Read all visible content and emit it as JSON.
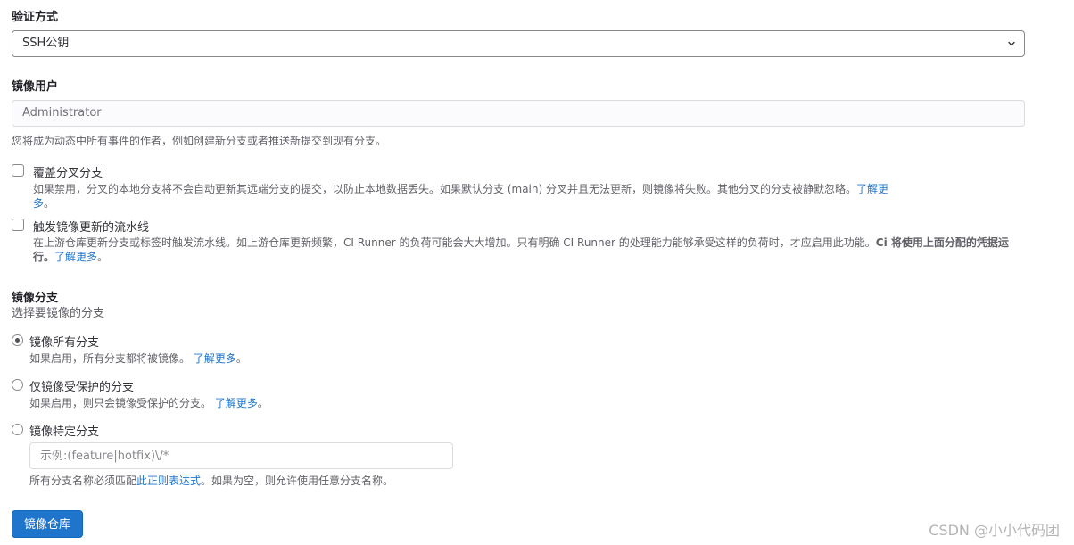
{
  "auth": {
    "label": "验证方式",
    "selected": "SSH公钥"
  },
  "mirror_user": {
    "label": "镜像用户",
    "value": "Administrator",
    "help": "您将成为动态中所有事件的作者，例如创建新分支或者推送新提交到现有分支。"
  },
  "overwrite": {
    "label": "覆盖分叉分支",
    "help_line1": "如果禁用，分叉的本地分支将不会自动更新其远端分支的提交，以防止本地数据丢失。如果默认分支 (main) 分叉并且无法更新，则镜像将失败。其他分叉的分支被静默忽略。",
    "link_line1": "了解更",
    "link_line2": "多",
    "period": "。"
  },
  "pipeline": {
    "label": "触发镜像更新的流水线",
    "help_line1": "在上游仓库更新分支或标签时触发流水线。如上游仓库更新频繁，CI Runner 的负荷可能会大大增加。只有明确 CI Runner 的处理能力能够承受这样的负荷时，才应启用此功能。",
    "help_bold": "Ci 将使用上面分配的凭据运行。",
    "link": "了解更多",
    "period": "。"
  },
  "branches": {
    "label": "镜像分支",
    "subtitle": "选择要镜像的分支",
    "options": [
      {
        "label": "镜像所有分支",
        "help": "如果启用，所有分支都将被镜像。",
        "link": "了解更多",
        "period": "。",
        "checked": true
      },
      {
        "label": "仅镜像受保护的分支",
        "help": "如果启用，则只会镜像受保护的分支。",
        "link": "了解更多",
        "period": "。",
        "checked": false
      },
      {
        "label": "镜像特定分支",
        "checked": false
      }
    ],
    "specific_placeholder": "示例:(feature|hotfix)\\/*",
    "specific_help_prefix": "所有分支名称必须匹配",
    "specific_help_link": "此正则表达式",
    "specific_help_suffix": "。如果为空，则允许使用任意分支名称。"
  },
  "submit": {
    "label": "镜像仓库"
  },
  "watermark": "CSDN @小小代码团",
  "colors": {
    "primary": "#1f75cb",
    "link": "#1f75cb",
    "text": "#333238",
    "muted": "#626168"
  }
}
